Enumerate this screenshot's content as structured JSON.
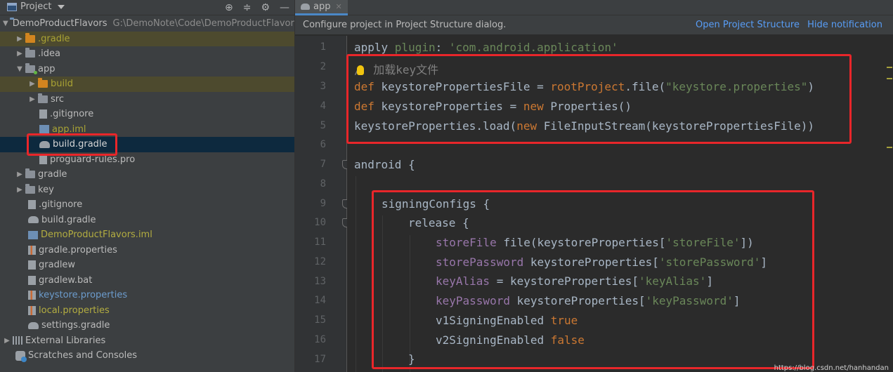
{
  "project_pane": {
    "title": "Project",
    "root": {
      "name": "DemoProductFlavors",
      "path": "G:\\DemoNote\\Code\\DemoProductFlavors"
    },
    "items": [
      {
        "label": ".gradle",
        "color": "yellow",
        "icon": "folder-orange"
      },
      {
        "label": ".idea",
        "color": "default",
        "icon": "folder"
      },
      {
        "label": "app",
        "color": "default",
        "icon": "module-folder"
      },
      {
        "label": "build",
        "color": "yellow",
        "icon": "folder-orange"
      },
      {
        "label": "src",
        "color": "default",
        "icon": "folder"
      },
      {
        "label": ".gitignore",
        "color": "default",
        "icon": "file"
      },
      {
        "label": "app.iml",
        "color": "yellow",
        "icon": "module-file"
      },
      {
        "label": "build.gradle",
        "color": "default",
        "icon": "gradle"
      },
      {
        "label": "proguard-rules.pro",
        "color": "default",
        "icon": "file"
      },
      {
        "label": "gradle",
        "color": "default",
        "icon": "folder"
      },
      {
        "label": "key",
        "color": "default",
        "icon": "folder"
      },
      {
        "label": ".gitignore",
        "color": "default",
        "icon": "file"
      },
      {
        "label": "build.gradle",
        "color": "default",
        "icon": "gradle"
      },
      {
        "label": "DemoProductFlavors.iml",
        "color": "olive",
        "icon": "module-file"
      },
      {
        "label": "gradle.properties",
        "color": "default",
        "icon": "properties"
      },
      {
        "label": "gradlew",
        "color": "default",
        "icon": "file"
      },
      {
        "label": "gradlew.bat",
        "color": "default",
        "icon": "file"
      },
      {
        "label": "keystore.properties",
        "color": "blue",
        "icon": "properties"
      },
      {
        "label": "local.properties",
        "color": "olive",
        "icon": "properties"
      },
      {
        "label": "settings.gradle",
        "color": "default",
        "icon": "gradle"
      },
      {
        "label": "External Libraries",
        "color": "default",
        "icon": "libraries"
      },
      {
        "label": "Scratches and Consoles",
        "color": "default",
        "icon": "scratch"
      }
    ]
  },
  "editor": {
    "tab": {
      "label": "app"
    },
    "notification": {
      "message": "Configure project in Project Structure dialog.",
      "open_link": "Open Project Structure",
      "hide_link": "Hide notification"
    },
    "line_numbers": [
      "1",
      "2",
      "3",
      "4",
      "5",
      "6",
      "7",
      "8",
      "9",
      "10",
      "11",
      "12",
      "13",
      "14",
      "15",
      "16",
      "17"
    ],
    "code": {
      "l1_a": "apply ",
      "l1_b": "plugin",
      "l1_c": ": ",
      "l1_d": "'com.android.application'",
      "l2_a": "/",
      "l2_b": " 加载key文件",
      "l3_a": "def",
      "l3_b": " keystorePropertiesFile = ",
      "l3_c": "rootProject",
      "l3_d": ".file(",
      "l3_e": "\"keystore.properties\"",
      "l3_f": ")",
      "l4_a": "def",
      "l4_b": " keystoreProperties = ",
      "l4_c": "new",
      "l4_d": " Properties()",
      "l5_a": "keystoreProperties.load(",
      "l5_b": "new",
      "l5_c": " FileInputStream(keystorePropertiesFile))",
      "l7": "android {",
      "l9": "signingConfigs {",
      "l10": "release {",
      "l11_a": "storeFile",
      "l11_b": " file(keystoreProperties[",
      "l11_c": "'storeFile'",
      "l11_d": "])",
      "l12_a": "storePassword",
      "l12_b": " keystoreProperties[",
      "l12_c": "'storePassword'",
      "l12_d": "]",
      "l13_a": "keyAlias",
      "l13_b": " = keystoreProperties[",
      "l13_c": "'keyAlias'",
      "l13_d": "]",
      "l14_a": "keyPassword",
      "l14_b": " keystoreProperties[",
      "l14_c": "'keyPassword'",
      "l14_d": "]",
      "l15_a": "v1SigningEnabled ",
      "l15_b": "true",
      "l16_a": "v2SigningEnabled ",
      "l16_b": "false",
      "l17": "}"
    }
  },
  "watermark": "https://blog.csdn.net/hanhandan",
  "colors": {
    "keyword": "#cc7832",
    "string": "#6a8759",
    "field": "#9876aa",
    "highlight_box": "#e8262a",
    "link": "#589df6"
  }
}
